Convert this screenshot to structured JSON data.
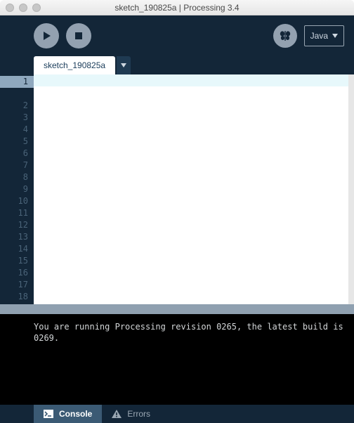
{
  "window": {
    "title": "sketch_190825a | Processing 3.4"
  },
  "toolbar": {
    "mode_label": "Java"
  },
  "tabs": [
    {
      "label": "sketch_190825a"
    }
  ],
  "editor": {
    "line_count": 18,
    "active_line": 1
  },
  "console": {
    "text": "You are running Processing revision 0265, the latest build is 0269."
  },
  "bottom_tabs": {
    "console": "Console",
    "errors": "Errors"
  }
}
